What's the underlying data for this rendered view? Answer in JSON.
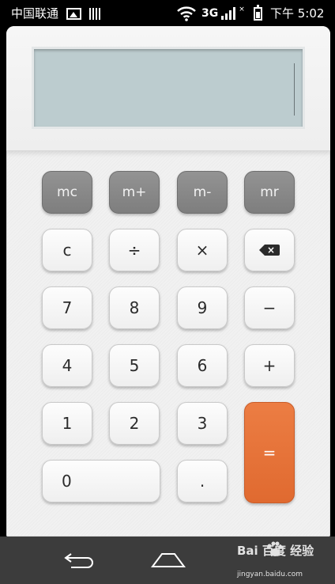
{
  "status_bar": {
    "carrier": "中国联通",
    "network": "3G",
    "sim_indicator": "×",
    "time": "下午 5:02"
  },
  "display": {
    "value": ""
  },
  "memory_keys": [
    "mc",
    "m+",
    "m-",
    "mr"
  ],
  "keys": {
    "clear": "c",
    "divide": "÷",
    "multiply": "×",
    "backspace_glyph": "×",
    "seven": "7",
    "eight": "8",
    "nine": "9",
    "minus": "−",
    "four": "4",
    "five": "5",
    "six": "6",
    "plus": "+",
    "one": "1",
    "two": "2",
    "three": "3",
    "equals": "=",
    "zero": "0",
    "decimal": "."
  },
  "watermark": {
    "main": "Bai 百度 经验",
    "sub": "jingyan.baidu.com"
  },
  "colors": {
    "equals_key": "#e06a30",
    "memory_key": "#848484",
    "display_bg": "#bccccf",
    "navbar_bg": "#3c3c3c"
  },
  "icons": [
    "gallery-icon",
    "sim-bars-icon",
    "wifi-icon",
    "signal-icon",
    "battery-icon",
    "backspace-icon",
    "back-icon",
    "home-icon",
    "baidu-paw-icon"
  ]
}
